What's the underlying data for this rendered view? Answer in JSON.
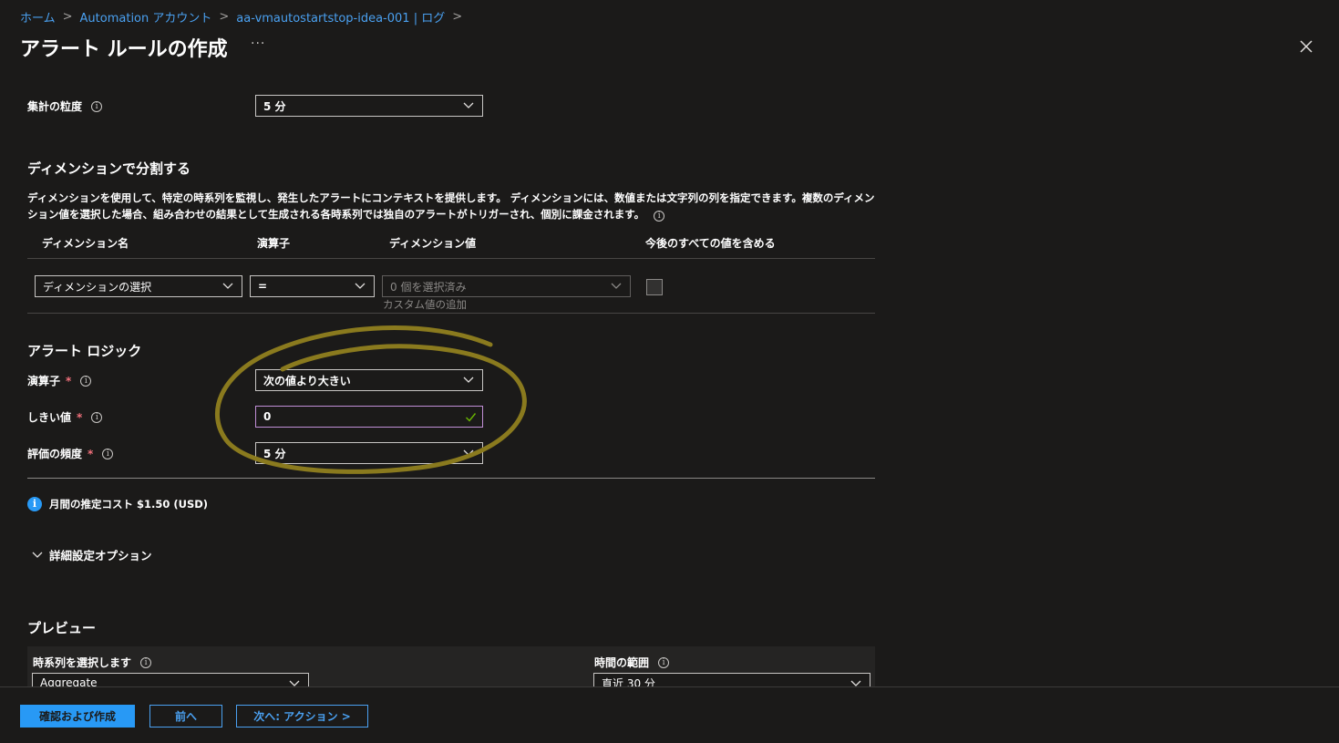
{
  "breadcrumb": {
    "items": [
      "ホーム",
      "Automation アカウント",
      "aa-vmautostartstop-idea-001 | ログ"
    ],
    "separator": ">"
  },
  "page": {
    "title": "アラート ルールの作成",
    "more_label": "···"
  },
  "aggregation": {
    "label": "集計の粒度",
    "value": "5 分"
  },
  "dimensions": {
    "heading": "ディメンションで分割する",
    "description": "ディメンションを使用して、特定の時系列を監視し、発生したアラートにコンテキストを提供します。 ディメンションには、数値または文字列の列を指定できます。複数のディメンション値を選択した場合、組み合わせの結果として生成される各時系列では独自のアラートがトリガーされ、個別に課金されます。",
    "columns": [
      "ディメンション名",
      "演算子",
      "ディメンション値",
      "今後のすべての値を含める"
    ],
    "row": {
      "name": "ディメンションの選択",
      "operator": "=",
      "value_placeholder": "0 個を選択済み",
      "add_custom": "カスタム値の追加"
    }
  },
  "alert_logic": {
    "heading": "アラート ロジック",
    "operator_label": "演算子",
    "operator_value": "次の値より大きい",
    "threshold_label": "しきい値",
    "threshold_value": "0",
    "frequency_label": "評価の頻度",
    "frequency_value": "5 分",
    "required_mark": "*"
  },
  "cost": {
    "text": "月間の推定コスト $1.50 (USD)"
  },
  "advanced": {
    "label": "詳細設定オプション"
  },
  "preview": {
    "heading": "プレビュー",
    "series_label": "時系列を選択します",
    "series_value": "Aggregate",
    "range_label": "時間の範囲",
    "range_value": "直近 30 分"
  },
  "footer": {
    "review_create": "確認および作成",
    "previous": "前へ",
    "next": "次へ: アクション >"
  },
  "colors": {
    "background": "#1b1a19",
    "link": "#4aa0f0",
    "primary": "#2899f5",
    "required": "#f1707b",
    "annotation": "#8a7a1e"
  }
}
